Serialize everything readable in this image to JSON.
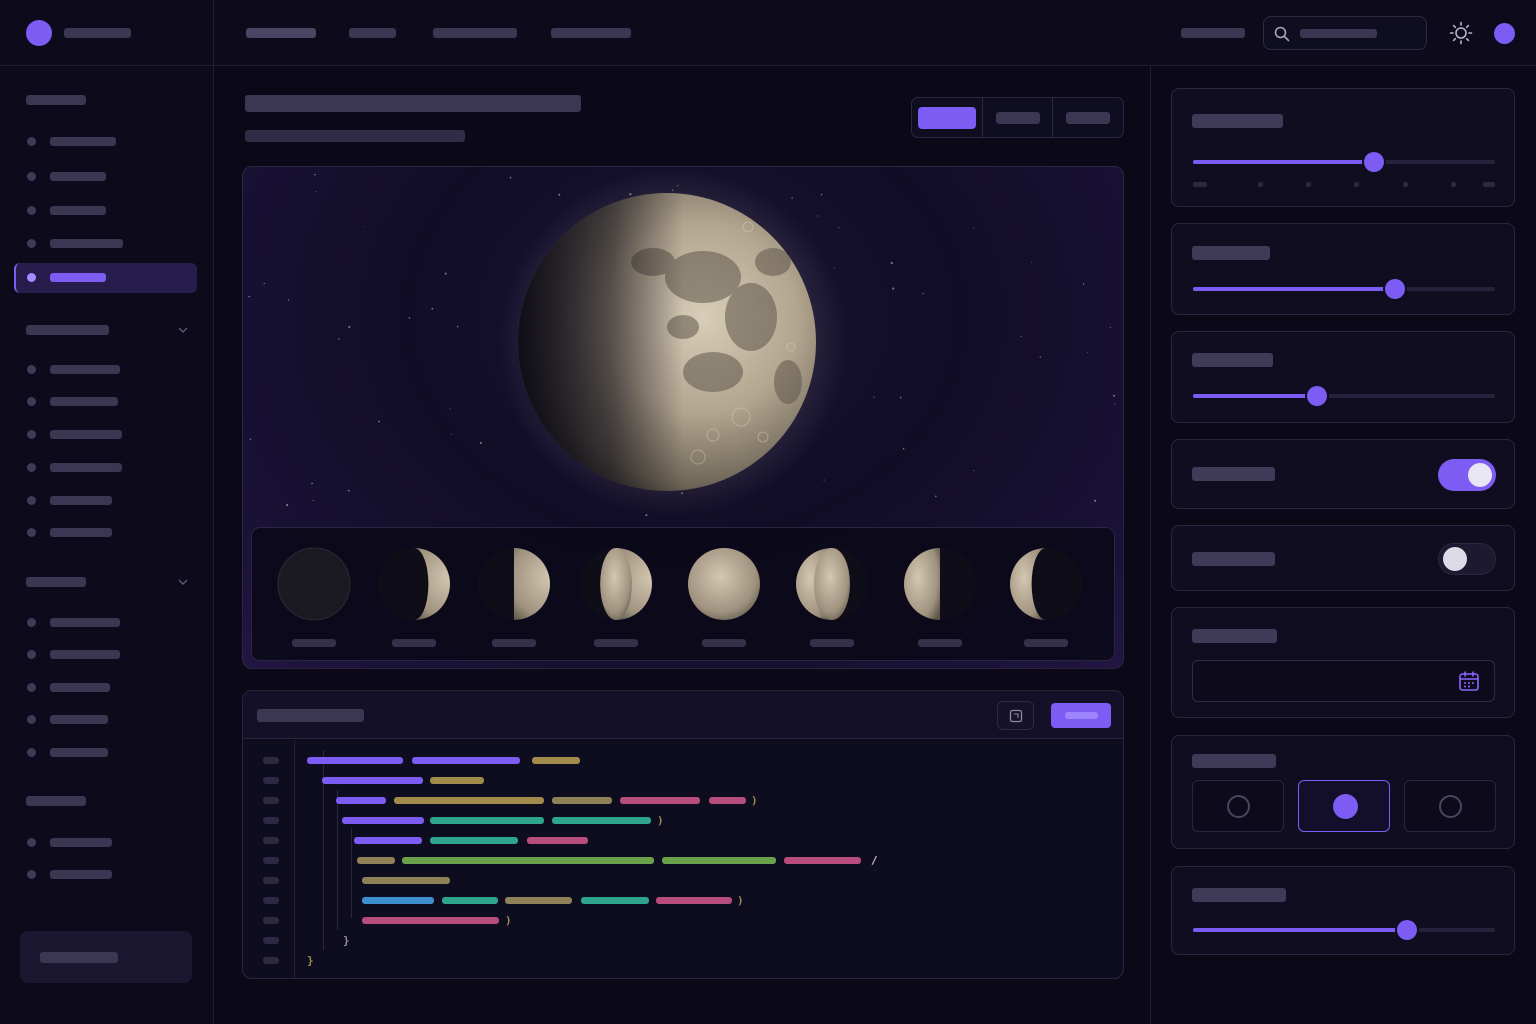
{
  "topbar": {
    "app_name": "",
    "nav": [
      "",
      "",
      "",
      ""
    ],
    "right_link": "",
    "search_placeholder": ""
  },
  "sidebar": {
    "sections": [
      {
        "title": "",
        "items": [
          "",
          "",
          "",
          "",
          ""
        ],
        "active_index": 4
      },
      {
        "title": "",
        "items": [
          "",
          "",
          "",
          "",
          "",
          ""
        ],
        "collapsible": true
      },
      {
        "title": "",
        "items": [
          "",
          "",
          "",
          "",
          ""
        ],
        "collapsible": true
      },
      {
        "title": "",
        "items": [
          "",
          ""
        ]
      }
    ],
    "bottom_button": ""
  },
  "main": {
    "title": "",
    "subtitle": "",
    "view_tabs": [
      "",
      "",
      ""
    ],
    "view_tab_selected": 0,
    "moon_view": {
      "phases": [
        {
          "icon": "new-moon-icon",
          "label": ""
        },
        {
          "icon": "waxing-crescent-icon",
          "label": ""
        },
        {
          "icon": "first-quarter-icon",
          "label": ""
        },
        {
          "icon": "waxing-gibbous-icon",
          "label": ""
        },
        {
          "icon": "full-moon-icon",
          "label": ""
        },
        {
          "icon": "waning-gibbous-icon",
          "label": ""
        },
        {
          "icon": "last-quarter-icon",
          "label": ""
        },
        {
          "icon": "waning-crescent-icon",
          "label": ""
        }
      ]
    },
    "code_panel": {
      "title": "",
      "run_label": "",
      "line_count": 11
    }
  },
  "controls": {
    "slider_1": {
      "label": "",
      "value": 0.6
    },
    "slider_2": {
      "label": "",
      "value": 0.67
    },
    "slider_3": {
      "label": "",
      "value": 0.41
    },
    "toggle_1": {
      "label": "",
      "on": true
    },
    "toggle_2": {
      "label": "",
      "on": false
    },
    "date": {
      "label": "",
      "value": ""
    },
    "radio_group": {
      "label": "",
      "options": [
        "",
        "",
        ""
      ],
      "selected_index": 1
    },
    "slider_4": {
      "label": "",
      "value": 0.71
    }
  },
  "colors": {
    "accent": "#7c5cf2",
    "background": "#0b0918",
    "syntax_purple": "#7c5cf2",
    "syntax_gold": "#a08a4c",
    "syntax_teal": "#2fa58e",
    "syntax_pink": "#b64d7c",
    "syntax_green": "#6aa14b",
    "syntax_blue": "#3d8fcf",
    "syntax_tan": "#8e8057"
  }
}
